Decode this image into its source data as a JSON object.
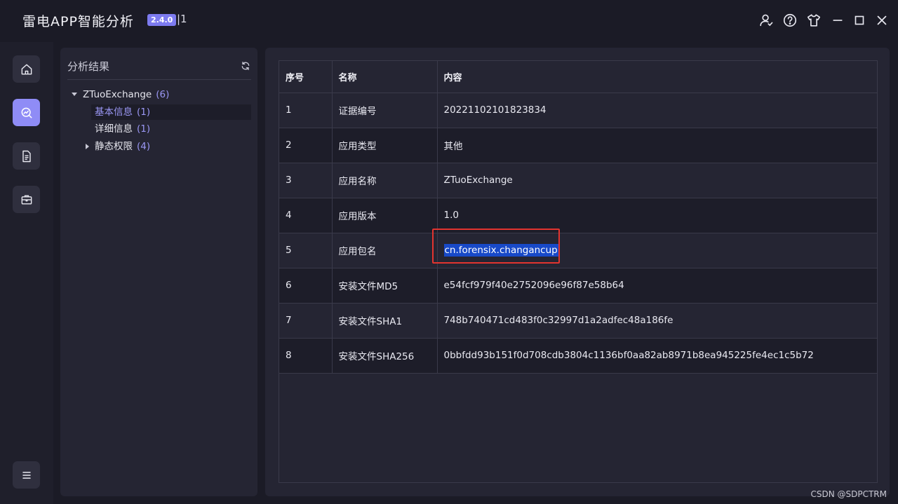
{
  "window": {
    "title": "雷电APP智能分析",
    "version": "2.4.0",
    "title_suffix": "|1",
    "controls": [
      "user-icon",
      "help-icon",
      "shirt-icon",
      "minimize-icon",
      "maximize-icon",
      "close-icon"
    ]
  },
  "rail": {
    "items": [
      {
        "icon": "home-icon",
        "active": false
      },
      {
        "icon": "analysis-icon",
        "active": true
      },
      {
        "icon": "document-icon",
        "active": false
      },
      {
        "icon": "briefcase-icon",
        "active": false
      }
    ],
    "bottom_icon": "menu-icon"
  },
  "tree": {
    "title": "分析结果",
    "root": {
      "label": "ZTuoExchange",
      "count": "(6)"
    },
    "children": [
      {
        "label": "基本信息",
        "count": "(1)",
        "selected": true
      },
      {
        "label": "详细信息",
        "count": "(1)",
        "selected": false
      },
      {
        "label": "静态权限",
        "count": "(4)",
        "selected": false
      }
    ]
  },
  "table": {
    "headers": {
      "index": "序号",
      "name": "名称",
      "content": "内容"
    },
    "rows": [
      {
        "index": "1",
        "name": "证据编号",
        "content": "20221102101823834"
      },
      {
        "index": "2",
        "name": "应用类型",
        "content": "其他"
      },
      {
        "index": "3",
        "name": "应用名称",
        "content": "ZTuoExchange"
      },
      {
        "index": "4",
        "name": "应用版本",
        "content": "1.0"
      },
      {
        "index": "5",
        "name": "应用包名",
        "content": "cn.forensix.changancup"
      },
      {
        "index": "6",
        "name": "安装文件MD5",
        "content": "e54fcf979f40e2752096e96f87e58b64"
      },
      {
        "index": "7",
        "name": "安装文件SHA1",
        "content": "748b740471cd483f0c32997d1a2adfec48a186fe"
      },
      {
        "index": "8",
        "name": "安装文件SHA256",
        "content": "0bbfdd93b151f0d708cdb3804c1136bf0aa82ab8971b8ea945225fe4ec1c5b72"
      }
    ]
  },
  "colors": {
    "accent": "#8f8cf6",
    "highlight_selection": "#1849c8",
    "annotation_box": "#e3342f"
  },
  "watermark": "CSDN @SDPCTRM"
}
